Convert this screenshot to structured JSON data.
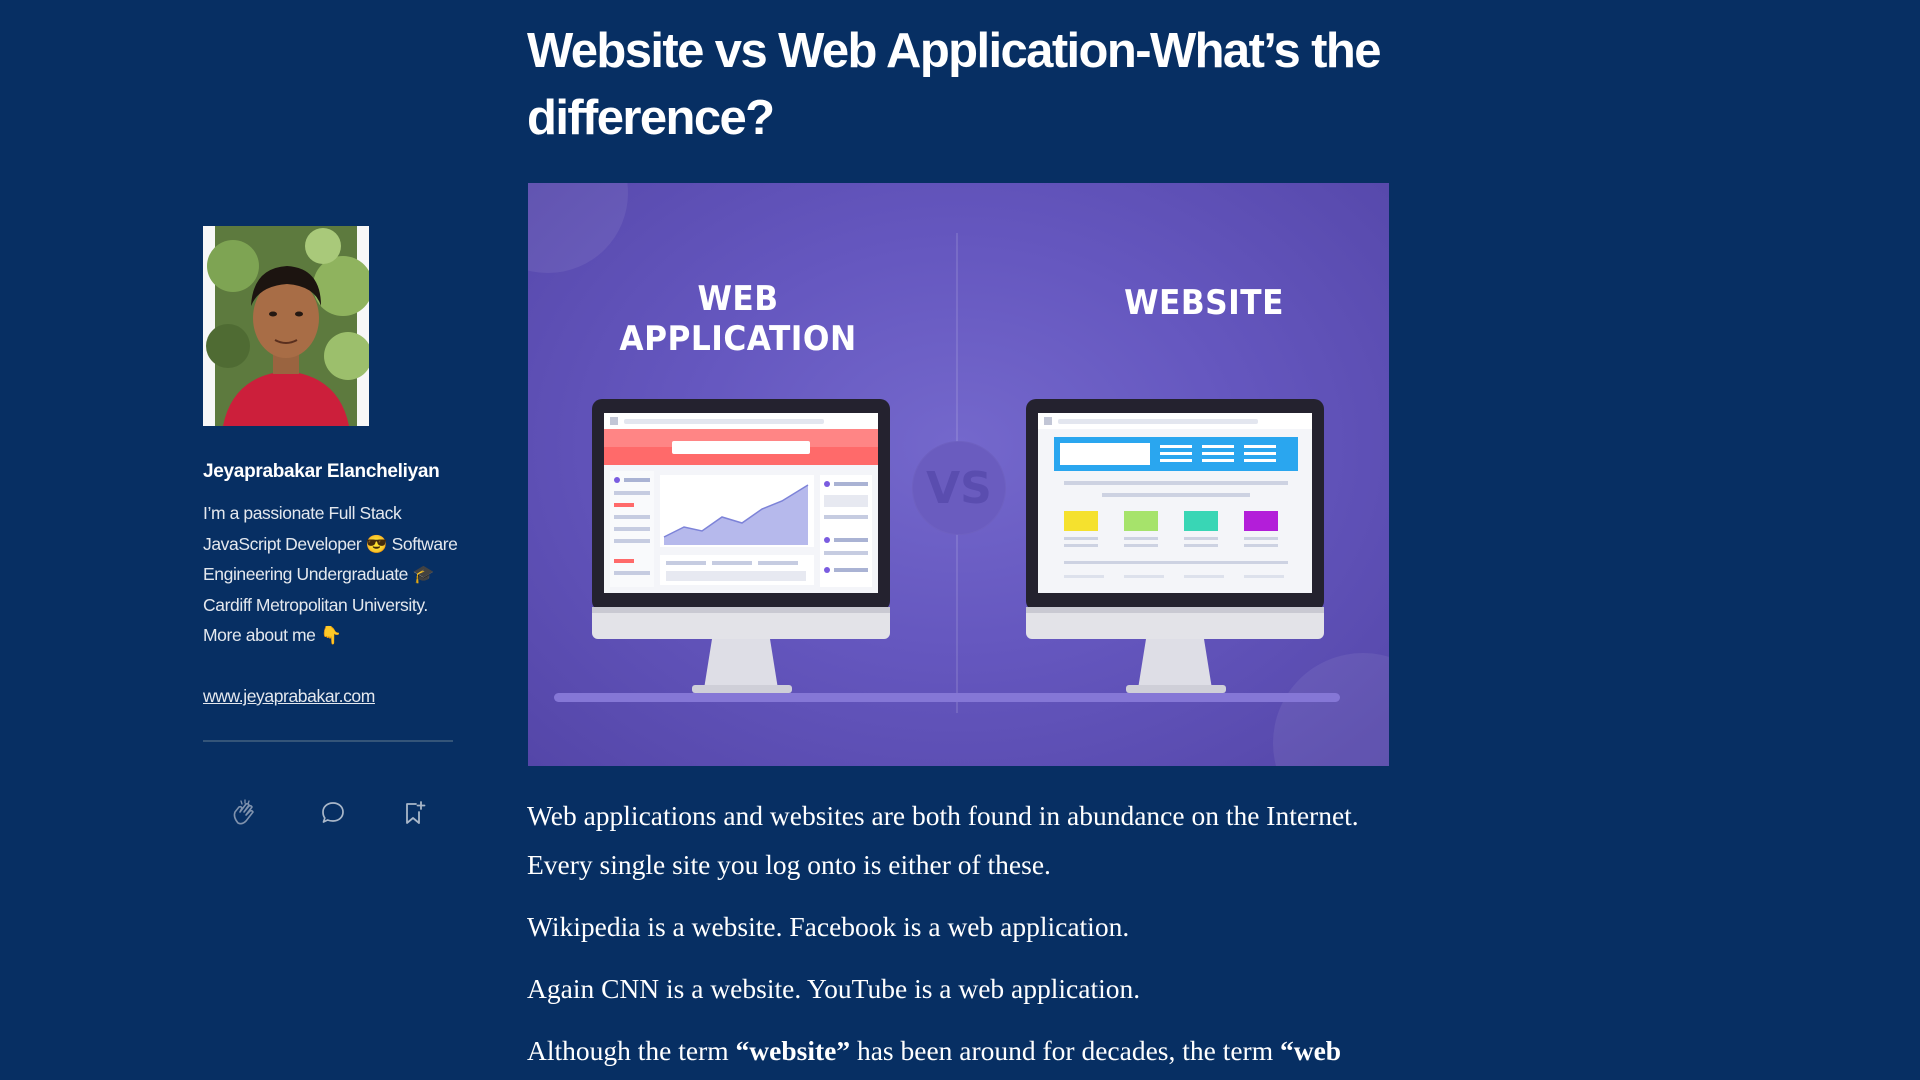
{
  "article": {
    "title": "Website vs Web Application-What’s the difference?",
    "paragraphs": [
      "Web applications and websites are both found in abundance on the Internet. Every single site you log onto is either of these.",
      "Wikipedia is a website. Facebook is a web application.",
      "Again CNN is a website. YouTube is a web application."
    ],
    "last_paragraph": {
      "text_1": "Although the term ",
      "bold_1": "“website”",
      "text_2": " has been around for decades, the term ",
      "bold_2": "“web"
    }
  },
  "hero_image": {
    "left_label": "WEB APPLICATION",
    "right_label": "WEBSITE",
    "vs_label": "VS"
  },
  "author": {
    "name": "Jeyaprabakar Elancheliyan",
    "bio": "I’m a passionate Full Stack JavaScript Developer 😎 Software Engineering Undergraduate 🎓 Cardiff Metropolitan University. More about me 👇",
    "link": "www.jeyaprabakar.com"
  },
  "actions": {
    "clap_icon": "clap-icon",
    "comment_icon": "comment-icon",
    "save_icon": "bookmark-add-icon"
  },
  "colors": {
    "page_background": "#072f63",
    "hero_background": "#6557bf",
    "app_header": "#ff6b6b",
    "site_header": "#2aa6ef"
  }
}
